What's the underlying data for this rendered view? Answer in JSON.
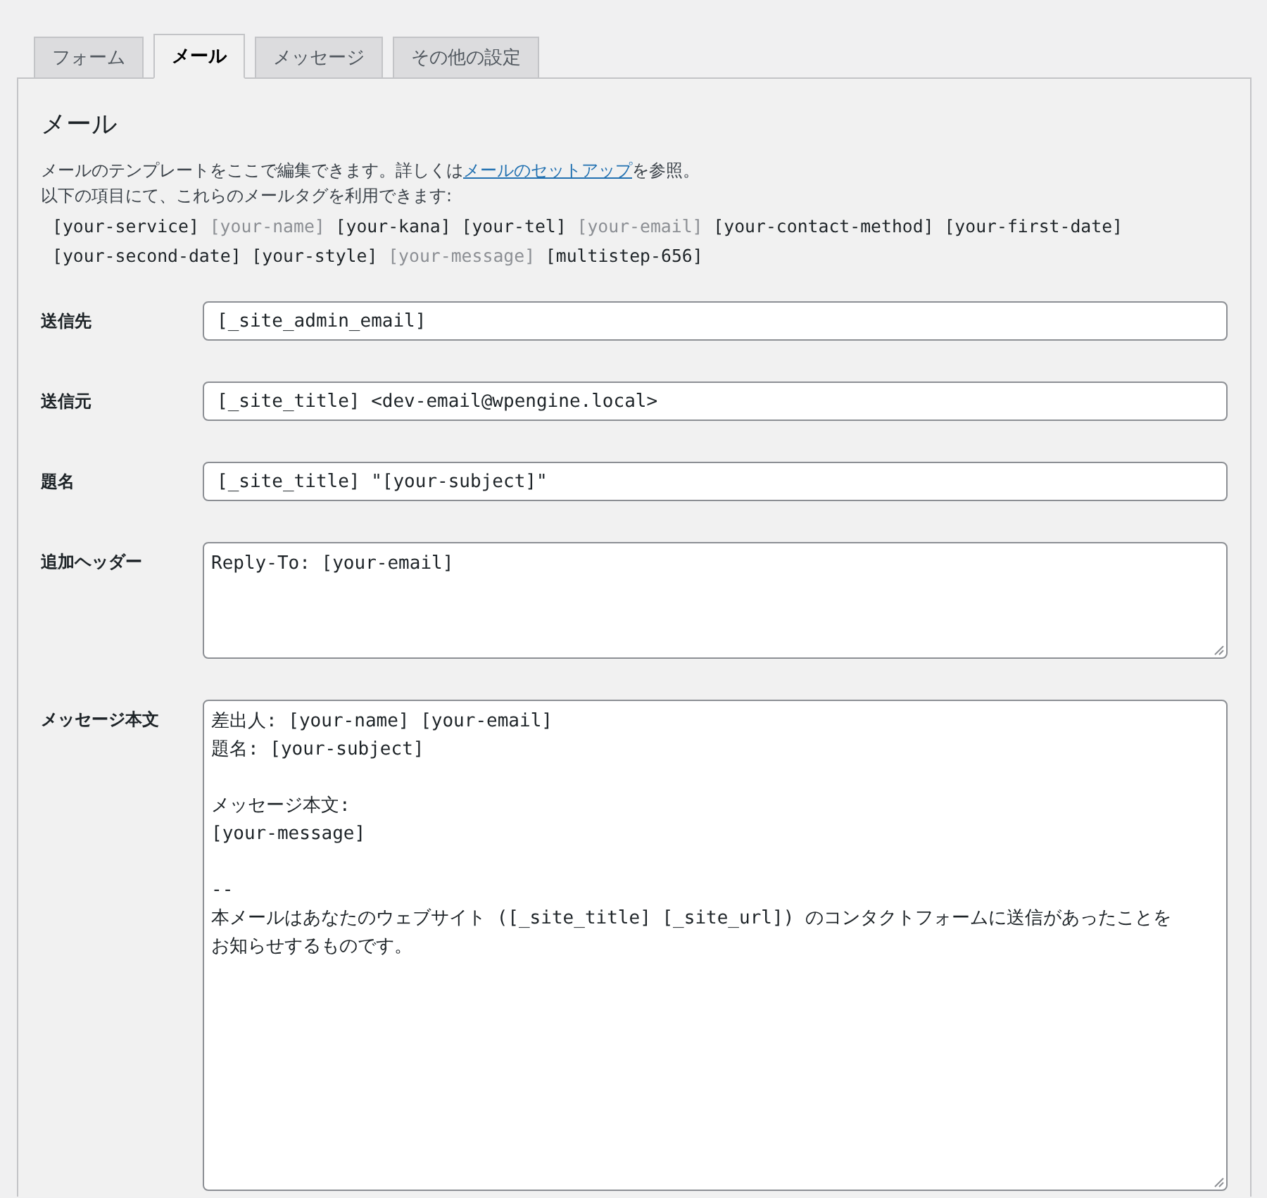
{
  "tabs": [
    {
      "label": "フォーム",
      "selected": false
    },
    {
      "label": "メール",
      "selected": true
    },
    {
      "label": "メッセージ",
      "selected": false
    },
    {
      "label": "その他の設定",
      "selected": false
    }
  ],
  "panel": {
    "title": "メール",
    "intro_before": "メールのテンプレートをここで編集できます。詳しくは",
    "intro_link": "メールのセットアップ",
    "intro_after": "を参照。",
    "tags_note": "以下の項目にて、これらのメールタグを利用できます:",
    "mail_tags": [
      {
        "label": "[your-service]",
        "used": false
      },
      {
        "label": "[your-name]",
        "used": true
      },
      {
        "label": "[your-kana]",
        "used": false
      },
      {
        "label": "[your-tel]",
        "used": false
      },
      {
        "label": "[your-email]",
        "used": true
      },
      {
        "label": "[your-contact-method]",
        "used": false
      },
      {
        "label": "[your-first-date]",
        "used": false
      },
      {
        "label": "[your-second-date]",
        "used": false
      },
      {
        "label": "[your-style]",
        "used": false
      },
      {
        "label": "[your-message]",
        "used": true
      },
      {
        "label": "[multistep-656]",
        "used": false
      }
    ],
    "fields": [
      {
        "label": "送信先",
        "kind": "input",
        "value": "[_site_admin_email]"
      },
      {
        "label": "送信元",
        "kind": "input",
        "value": "[_site_title] <dev-email@wpengine.local>"
      },
      {
        "label": "題名",
        "kind": "input",
        "value": "[_site_title] \"[your-subject]\""
      },
      {
        "label": "追加ヘッダー",
        "kind": "textarea",
        "paragraphs": [
          [
            "Reply-To: [your-email]"
          ]
        ]
      },
      {
        "label": "メッセージ本文",
        "kind": "tall-textarea",
        "paragraphs": [
          [
            "差出人: [your-name] [your-email]",
            "題名: [your-subject]"
          ],
          [
            "メッセージ本文:",
            "[your-message]"
          ],
          [
            "--",
            "本メールはあなたのウェブサイト ([_site_title] [_site_url]) のコンタクトフォームに送信があったことを",
            "お知らせするものです。"
          ]
        ]
      }
    ]
  }
}
